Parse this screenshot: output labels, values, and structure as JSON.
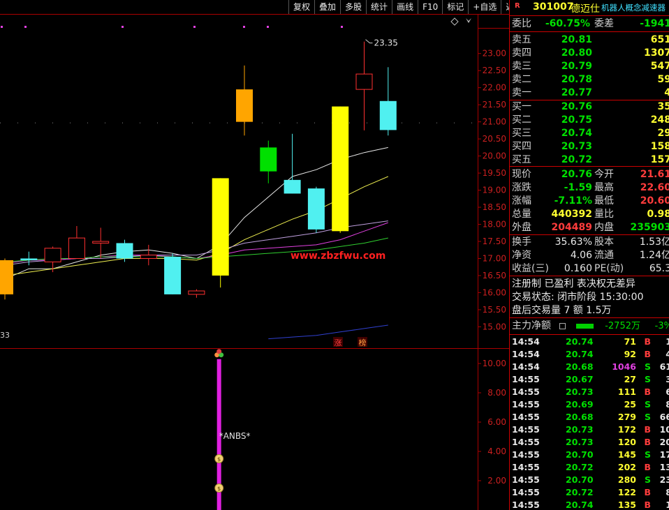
{
  "toolbar": {
    "items": [
      "复权",
      "叠加",
      "多股",
      "统计",
      "画线",
      "F10",
      "标记",
      "+自选",
      "返回"
    ]
  },
  "stock": {
    "badge": "R",
    "code": "301007",
    "name": "德迈仕",
    "concept": "机器人概念减速器"
  },
  "ratio": {
    "l1": "委比",
    "v1": "-60.75%",
    "l2": "委差",
    "v2": "-1941"
  },
  "asks": [
    {
      "label": "卖五",
      "price": "20.81",
      "vol": "651"
    },
    {
      "label": "卖四",
      "price": "20.80",
      "vol": "1307"
    },
    {
      "label": "卖三",
      "price": "20.79",
      "vol": "547"
    },
    {
      "label": "卖二",
      "price": "20.78",
      "vol": "59"
    },
    {
      "label": "卖一",
      "price": "20.77",
      "vol": "4"
    }
  ],
  "bids": [
    {
      "label": "买一",
      "price": "20.76",
      "vol": "35"
    },
    {
      "label": "买二",
      "price": "20.75",
      "vol": "248"
    },
    {
      "label": "买三",
      "price": "20.74",
      "vol": "29"
    },
    {
      "label": "买四",
      "price": "20.73",
      "vol": "158"
    },
    {
      "label": "买五",
      "price": "20.72",
      "vol": "157"
    }
  ],
  "quote": [
    {
      "l1": "现价",
      "v1": "20.76",
      "l2": "今开",
      "v2": "21.61"
    },
    {
      "l1": "涨跌",
      "v1": "-1.59",
      "l2": "最高",
      "v2": "22.60"
    },
    {
      "l1": "涨幅",
      "v1": "-7.11%",
      "l2": "最低",
      "v2": "20.60"
    },
    {
      "l1": "总量",
      "v1": "440392",
      "l2": "量比",
      "v2": "0.98"
    },
    {
      "l1": "外盘",
      "v1": "204489",
      "l2": "内盘",
      "v2": "235903"
    }
  ],
  "fin": [
    {
      "l1": "换手",
      "v1": "35.63%",
      "l2": "股本",
      "v2": "1.53亿"
    },
    {
      "l1": "净资",
      "v1": "4.06",
      "l2": "流通",
      "v2": "1.24亿"
    },
    {
      "l1": "收益(三)",
      "v1": "0.160",
      "l2": "PE(动)",
      "v2": "65.3"
    }
  ],
  "info": {
    "line1": "注册制 已盈利 表决权无差异",
    "line2": "交易状态: 闭市阶段 15:30:00",
    "line3": "盘后交易量 7 额 1.5万"
  },
  "mainflow": {
    "label": "主力净额",
    "value": "-2752万",
    "pct": "-3%"
  },
  "ticks": [
    {
      "t": "14:54",
      "p": "20.74",
      "v": "71",
      "s": "B",
      "n": "1"
    },
    {
      "t": "14:54",
      "p": "20.74",
      "v": "92",
      "s": "B",
      "n": "4"
    },
    {
      "t": "14:54",
      "p": "20.68",
      "v": "1046",
      "s": "S",
      "n": "61"
    },
    {
      "t": "14:55",
      "p": "20.67",
      "v": "27",
      "s": "S",
      "n": "3"
    },
    {
      "t": "14:55",
      "p": "20.73",
      "v": "111",
      "s": "B",
      "n": "6"
    },
    {
      "t": "14:55",
      "p": "20.69",
      "v": "25",
      "s": "S",
      "n": "8"
    },
    {
      "t": "14:55",
      "p": "20.68",
      "v": "279",
      "s": "S",
      "n": "66"
    },
    {
      "t": "14:55",
      "p": "20.73",
      "v": "172",
      "s": "B",
      "n": "10"
    },
    {
      "t": "14:55",
      "p": "20.73",
      "v": "120",
      "s": "B",
      "n": "20"
    },
    {
      "t": "14:55",
      "p": "20.70",
      "v": "145",
      "s": "S",
      "n": "17"
    },
    {
      "t": "14:55",
      "p": "20.72",
      "v": "202",
      "s": "B",
      "n": "13"
    },
    {
      "t": "14:55",
      "p": "20.70",
      "v": "280",
      "s": "S",
      "n": "23"
    },
    {
      "t": "14:55",
      "p": "20.72",
      "v": "122",
      "s": "B",
      "n": "8"
    },
    {
      "t": "14:55",
      "p": "20.74",
      "v": "135",
      "s": "B",
      "n": "1"
    }
  ],
  "chart_data": {
    "type": "candlestick",
    "price_axis": {
      "ticks": [
        "23.00",
        "22.50",
        "22.00",
        "21.50",
        "21.00",
        "20.50",
        "20.00",
        "19.50",
        "19.00",
        "18.50",
        "18.00",
        "17.50",
        "17.00",
        "16.50",
        "16.00",
        "15.50",
        "15.00"
      ],
      "range": [
        14.6,
        23.75
      ]
    },
    "candles": [
      {
        "o": 15.95,
        "c": 16.95,
        "h": 17.0,
        "l": 15.8,
        "color": "orange"
      },
      {
        "o": 16.95,
        "c": 17.0,
        "h": 17.2,
        "l": 16.8,
        "color": "cyan"
      },
      {
        "o": 17.3,
        "c": 16.9,
        "h": 17.35,
        "l": 16.6,
        "color": "red-hollow"
      },
      {
        "o": 17.0,
        "c": 17.6,
        "h": 17.95,
        "l": 17.0,
        "color": "red-hollow"
      },
      {
        "o": 17.45,
        "c": 17.5,
        "h": 17.9,
        "l": 17.0,
        "color": "red-hollow"
      },
      {
        "o": 17.45,
        "c": 17.0,
        "h": 17.55,
        "l": 16.9,
        "color": "cyan"
      },
      {
        "o": 17.0,
        "c": 17.1,
        "h": 17.4,
        "l": 16.8,
        "color": "red-hollow"
      },
      {
        "o": 17.05,
        "c": 15.95,
        "h": 17.15,
        "l": 15.95,
        "color": "cyan"
      },
      {
        "o": 15.95,
        "c": 16.05,
        "h": 16.1,
        "l": 15.85,
        "color": "red-hollow"
      },
      {
        "o": 16.5,
        "c": 19.35,
        "h": 19.35,
        "l": 16.15,
        "color": "yellow"
      },
      {
        "o": 21.95,
        "c": 21.0,
        "h": 22.65,
        "l": 20.6,
        "color": "orange"
      },
      {
        "o": 20.25,
        "c": 19.55,
        "h": 20.45,
        "l": 19.2,
        "color": "green"
      },
      {
        "o": 19.3,
        "c": 18.9,
        "h": 20.65,
        "l": 18.9,
        "color": "cyan"
      },
      {
        "o": 19.05,
        "c": 17.85,
        "h": 19.1,
        "l": 17.75,
        "color": "cyan"
      },
      {
        "o": 17.8,
        "c": 21.45,
        "h": 21.45,
        "l": 17.75,
        "color": "yellow"
      },
      {
        "o": 21.95,
        "c": 22.4,
        "h": 23.35,
        "l": 20.75,
        "color": "red-hollow"
      },
      {
        "o": 21.61,
        "c": 20.76,
        "h": 22.6,
        "l": 20.6,
        "color": "cyan"
      }
    ],
    "high_label": "23.35",
    "partial_low_label": "33",
    "tags": [
      "涨",
      "榜"
    ],
    "ma_lines": [
      {
        "color": "#e8e8e8",
        "values": [
          16.4,
          16.7,
          16.7,
          16.9,
          17.1,
          17.2,
          17.25,
          17.15,
          17.0,
          17.4,
          18.2,
          18.8,
          19.4,
          19.6,
          19.9,
          20.1,
          20.25
        ]
      },
      {
        "color": "#f0f050",
        "values": [
          16.5,
          16.6,
          16.7,
          16.8,
          16.9,
          17.0,
          17.0,
          17.0,
          16.95,
          17.15,
          17.55,
          17.85,
          18.15,
          18.4,
          18.75,
          19.1,
          19.4
        ]
      },
      {
        "color": "#c0a0e0",
        "values": [
          16.8,
          16.9,
          16.95,
          17.0,
          17.0,
          17.05,
          17.1,
          17.1,
          17.1,
          17.25,
          17.45,
          17.55,
          17.65,
          17.75,
          17.9,
          18.0,
          18.1
        ]
      },
      {
        "color": "#e040e0",
        "values": [
          16.85,
          16.95,
          16.95,
          17.0,
          17.05,
          17.1,
          17.1,
          17.05,
          17.0,
          17.1,
          17.25,
          17.3,
          17.35,
          17.4,
          17.55,
          17.8,
          18.05
        ]
      },
      {
        "color": "#30d030",
        "values": [
          16.9,
          16.95,
          17.0,
          17.0,
          17.05,
          17.05,
          17.05,
          17.05,
          17.0,
          17.05,
          17.1,
          17.15,
          17.2,
          17.25,
          17.35,
          17.45,
          17.6
        ]
      },
      {
        "color": "#3040d0",
        "values": [
          null,
          null,
          null,
          null,
          null,
          null,
          null,
          null,
          null,
          null,
          null,
          14.65,
          14.7,
          14.75,
          14.85,
          14.95,
          15.05
        ]
      }
    ],
    "lower_axis": {
      "ticks": [
        "10.00",
        "8.00",
        "6.00",
        "4.00",
        "2.00"
      ],
      "range": [
        0,
        11.0
      ]
    },
    "lower_label": "*ANBS*",
    "lower_bar": {
      "candle_index": 9,
      "from": 0,
      "to": 10.3
    }
  }
}
